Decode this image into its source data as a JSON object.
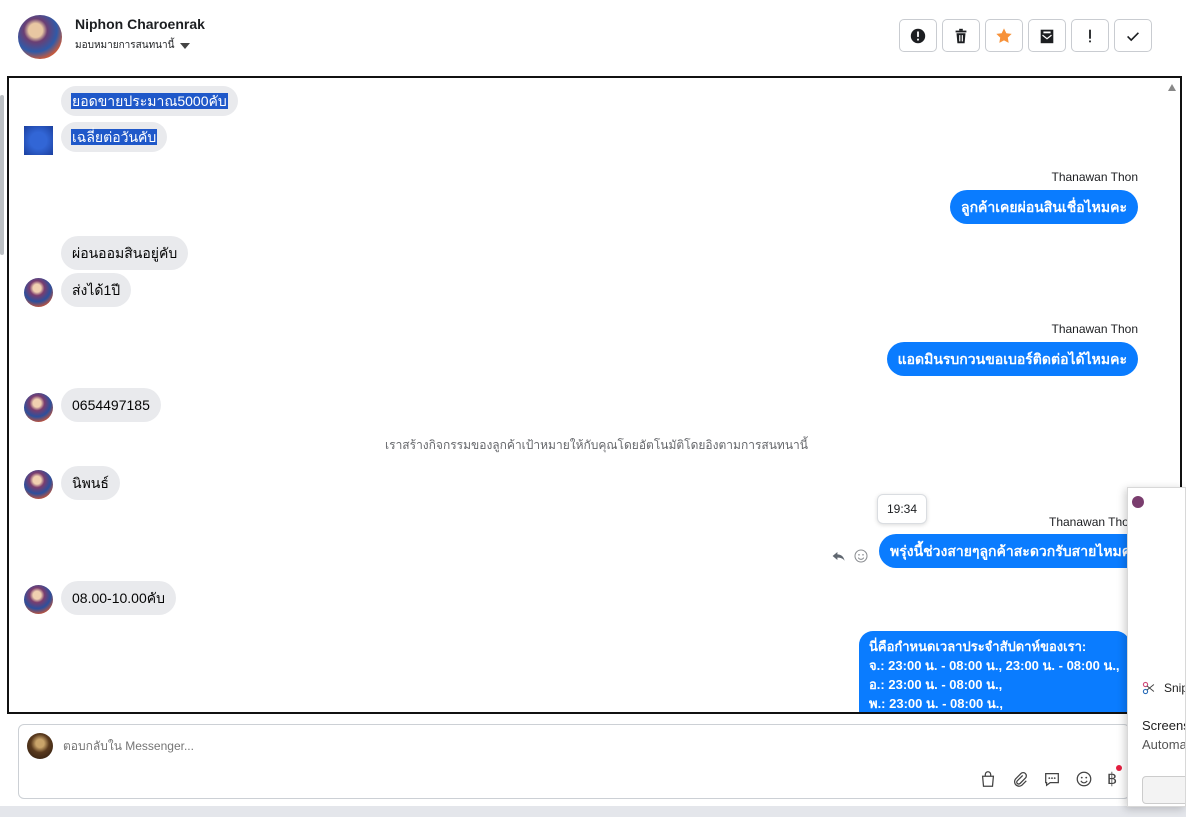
{
  "header": {
    "contact_name": "Niphon Charoenrak",
    "assign_label": "มอบหมายการสนทนานี้",
    "toolbar": [
      {
        "name": "mark-spam-button",
        "icon": "alert-circle-icon"
      },
      {
        "name": "delete-button",
        "icon": "trash-icon"
      },
      {
        "name": "star-button",
        "icon": "star-icon",
        "color": "#f7923a"
      },
      {
        "name": "mark-unread-button",
        "icon": "envelope-icon"
      },
      {
        "name": "follow-up-button",
        "icon": "exclamation-icon"
      },
      {
        "name": "mark-done-button",
        "icon": "check-icon"
      }
    ]
  },
  "messages": {
    "m1": "ยอดขายประมาณ5000คับ",
    "m2": "เฉลี่ยต่อวันคับ",
    "sender1": "Thanawan Thon",
    "m3": "ลูกค้าเคยผ่อนสินเชื่อไหมคะ",
    "m4": "ผ่อนออมสินอยู่คับ",
    "m5": "ส่งได้1ปี",
    "sender2": "Thanawan Thon",
    "m6": "แอดมินรบกวนขอเบอร์ติดต่อได้ไหมคะ",
    "m7": "0654497185",
    "system_note": "เราสร้างกิจกรรมของลูกค้าเป้าหมายให้กับคุณโดยอัตโนมัติโดยอิงตามการสนทนานี้",
    "m8": "นิพนธ์",
    "tooltip_time": "19:34",
    "sender3": "Thanawan Tho",
    "m9": "พรุ่งนี้ช่วงสายๆลูกค้าสะดวกรับสายไหมคะ",
    "m10": "08.00-10.00คับ",
    "schedule": {
      "line1": "นี่คือกำหนดเวลาประจำสัปดาห์ของเรา:",
      "line2": "จ.: 23:00 น. - 08:00 น., 23:00 น. - 08:00 น.,",
      "line3": "อ.: 23:00 น. - 08:00 น.,",
      "line4": "พ.: 23:00 น. - 08:00 น.,"
    }
  },
  "composer": {
    "placeholder": "ตอบกลับใน Messenger...",
    "currency_symbol": "฿",
    "icons": [
      "shopping-bag-icon",
      "paperclip-icon",
      "chat-bubble-icon",
      "emoji-icon",
      "baht-icon"
    ]
  },
  "snip_notification": {
    "app": "Snip",
    "title": "Screens",
    "subtitle": "Automa"
  },
  "colors": {
    "accent": "#0a7cff",
    "incoming_bubble": "#e9eaed",
    "selection": "#1f58c9"
  }
}
